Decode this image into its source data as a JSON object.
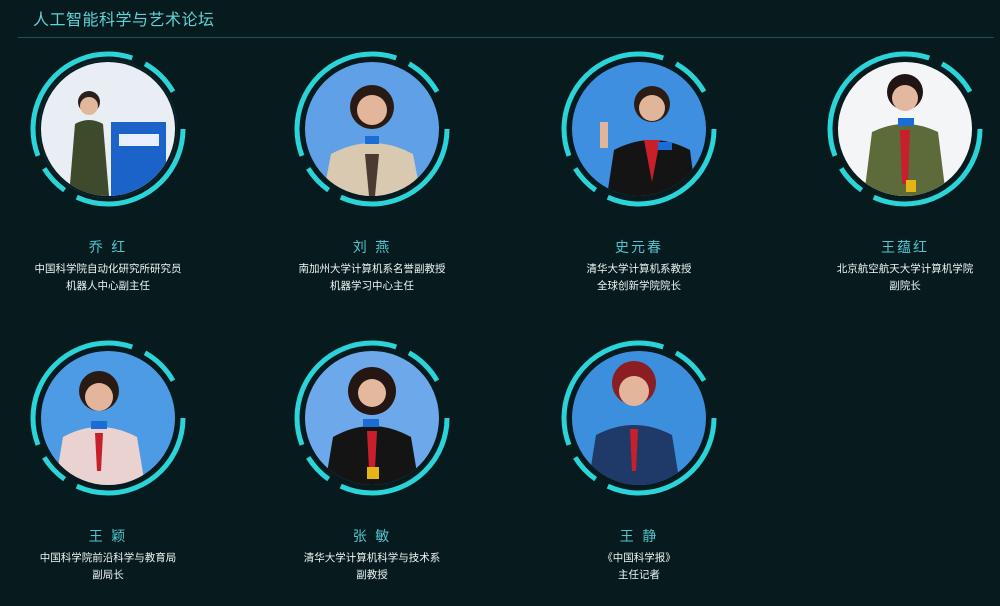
{
  "header": {
    "title": "人工智能科学与艺术论坛"
  },
  "speakers": [
    {
      "name": "乔 红",
      "line1": "中国科学院自动化研究所研究员",
      "line2": "机器人中心副主任"
    },
    {
      "name": "刘 燕",
      "line1": "南加州大学计算机系名誉副教授",
      "line2": "机器学习中心主任"
    },
    {
      "name": "史元春",
      "line1": "清华大学计算机系教授",
      "line2": "全球创新学院院长"
    },
    {
      "name": "王蕴红",
      "line1": "北京航空航天大学计算机学院",
      "line2": "副院长"
    },
    {
      "name": "王 颖",
      "line1": "中国科学院前沿科学与教育局",
      "line2": "副局长"
    },
    {
      "name": "张 敏",
      "line1": "清华大学计算机科学与技术系",
      "line2": "副教授"
    },
    {
      "name": "王 静",
      "line1": "《中国科学报》",
      "line2": "主任记者"
    }
  ],
  "colors": {
    "background": "#071a1d",
    "accent": "#2ad4d8",
    "name": "#4fc6cf",
    "text": "#eef6f6"
  }
}
